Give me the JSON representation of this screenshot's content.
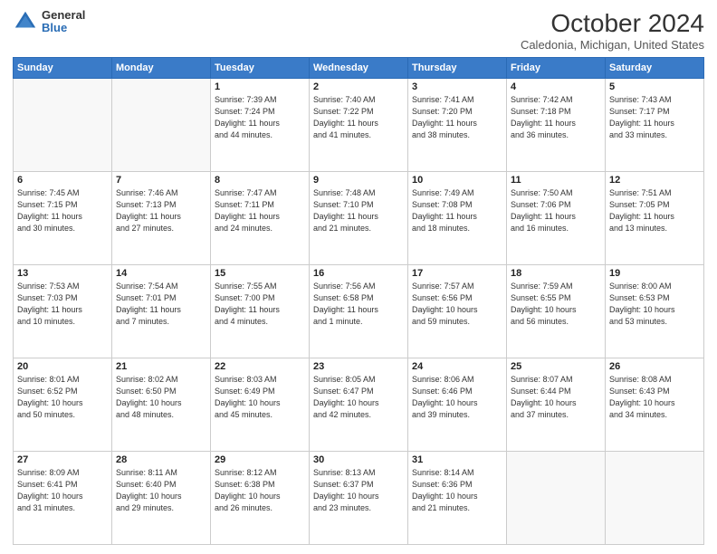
{
  "header": {
    "logo_general": "General",
    "logo_blue": "Blue",
    "month_title": "October 2024",
    "location": "Caledonia, Michigan, United States"
  },
  "weekdays": [
    "Sunday",
    "Monday",
    "Tuesday",
    "Wednesday",
    "Thursday",
    "Friday",
    "Saturday"
  ],
  "weeks": [
    [
      {
        "day": "",
        "detail": ""
      },
      {
        "day": "",
        "detail": ""
      },
      {
        "day": "1",
        "detail": "Sunrise: 7:39 AM\nSunset: 7:24 PM\nDaylight: 11 hours\nand 44 minutes."
      },
      {
        "day": "2",
        "detail": "Sunrise: 7:40 AM\nSunset: 7:22 PM\nDaylight: 11 hours\nand 41 minutes."
      },
      {
        "day": "3",
        "detail": "Sunrise: 7:41 AM\nSunset: 7:20 PM\nDaylight: 11 hours\nand 38 minutes."
      },
      {
        "day": "4",
        "detail": "Sunrise: 7:42 AM\nSunset: 7:18 PM\nDaylight: 11 hours\nand 36 minutes."
      },
      {
        "day": "5",
        "detail": "Sunrise: 7:43 AM\nSunset: 7:17 PM\nDaylight: 11 hours\nand 33 minutes."
      }
    ],
    [
      {
        "day": "6",
        "detail": "Sunrise: 7:45 AM\nSunset: 7:15 PM\nDaylight: 11 hours\nand 30 minutes."
      },
      {
        "day": "7",
        "detail": "Sunrise: 7:46 AM\nSunset: 7:13 PM\nDaylight: 11 hours\nand 27 minutes."
      },
      {
        "day": "8",
        "detail": "Sunrise: 7:47 AM\nSunset: 7:11 PM\nDaylight: 11 hours\nand 24 minutes."
      },
      {
        "day": "9",
        "detail": "Sunrise: 7:48 AM\nSunset: 7:10 PM\nDaylight: 11 hours\nand 21 minutes."
      },
      {
        "day": "10",
        "detail": "Sunrise: 7:49 AM\nSunset: 7:08 PM\nDaylight: 11 hours\nand 18 minutes."
      },
      {
        "day": "11",
        "detail": "Sunrise: 7:50 AM\nSunset: 7:06 PM\nDaylight: 11 hours\nand 16 minutes."
      },
      {
        "day": "12",
        "detail": "Sunrise: 7:51 AM\nSunset: 7:05 PM\nDaylight: 11 hours\nand 13 minutes."
      }
    ],
    [
      {
        "day": "13",
        "detail": "Sunrise: 7:53 AM\nSunset: 7:03 PM\nDaylight: 11 hours\nand 10 minutes."
      },
      {
        "day": "14",
        "detail": "Sunrise: 7:54 AM\nSunset: 7:01 PM\nDaylight: 11 hours\nand 7 minutes."
      },
      {
        "day": "15",
        "detail": "Sunrise: 7:55 AM\nSunset: 7:00 PM\nDaylight: 11 hours\nand 4 minutes."
      },
      {
        "day": "16",
        "detail": "Sunrise: 7:56 AM\nSunset: 6:58 PM\nDaylight: 11 hours\nand 1 minute."
      },
      {
        "day": "17",
        "detail": "Sunrise: 7:57 AM\nSunset: 6:56 PM\nDaylight: 10 hours\nand 59 minutes."
      },
      {
        "day": "18",
        "detail": "Sunrise: 7:59 AM\nSunset: 6:55 PM\nDaylight: 10 hours\nand 56 minutes."
      },
      {
        "day": "19",
        "detail": "Sunrise: 8:00 AM\nSunset: 6:53 PM\nDaylight: 10 hours\nand 53 minutes."
      }
    ],
    [
      {
        "day": "20",
        "detail": "Sunrise: 8:01 AM\nSunset: 6:52 PM\nDaylight: 10 hours\nand 50 minutes."
      },
      {
        "day": "21",
        "detail": "Sunrise: 8:02 AM\nSunset: 6:50 PM\nDaylight: 10 hours\nand 48 minutes."
      },
      {
        "day": "22",
        "detail": "Sunrise: 8:03 AM\nSunset: 6:49 PM\nDaylight: 10 hours\nand 45 minutes."
      },
      {
        "day": "23",
        "detail": "Sunrise: 8:05 AM\nSunset: 6:47 PM\nDaylight: 10 hours\nand 42 minutes."
      },
      {
        "day": "24",
        "detail": "Sunrise: 8:06 AM\nSunset: 6:46 PM\nDaylight: 10 hours\nand 39 minutes."
      },
      {
        "day": "25",
        "detail": "Sunrise: 8:07 AM\nSunset: 6:44 PM\nDaylight: 10 hours\nand 37 minutes."
      },
      {
        "day": "26",
        "detail": "Sunrise: 8:08 AM\nSunset: 6:43 PM\nDaylight: 10 hours\nand 34 minutes."
      }
    ],
    [
      {
        "day": "27",
        "detail": "Sunrise: 8:09 AM\nSunset: 6:41 PM\nDaylight: 10 hours\nand 31 minutes."
      },
      {
        "day": "28",
        "detail": "Sunrise: 8:11 AM\nSunset: 6:40 PM\nDaylight: 10 hours\nand 29 minutes."
      },
      {
        "day": "29",
        "detail": "Sunrise: 8:12 AM\nSunset: 6:38 PM\nDaylight: 10 hours\nand 26 minutes."
      },
      {
        "day": "30",
        "detail": "Sunrise: 8:13 AM\nSunset: 6:37 PM\nDaylight: 10 hours\nand 23 minutes."
      },
      {
        "day": "31",
        "detail": "Sunrise: 8:14 AM\nSunset: 6:36 PM\nDaylight: 10 hours\nand 21 minutes."
      },
      {
        "day": "",
        "detail": ""
      },
      {
        "day": "",
        "detail": ""
      }
    ]
  ]
}
